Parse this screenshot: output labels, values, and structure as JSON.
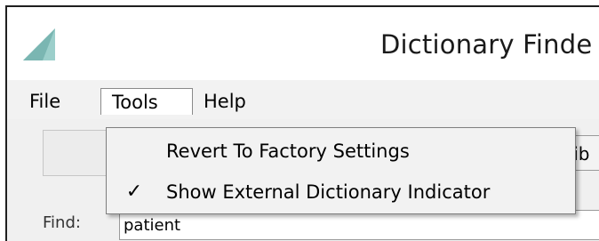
{
  "window": {
    "title": "Dictionary Finde",
    "logo_icon": "app-logo-icon",
    "accent_color": "#8fc3c0"
  },
  "menubar": {
    "items": [
      {
        "label": "File"
      },
      {
        "label": "Tools",
        "active": true
      },
      {
        "label": "Help"
      }
    ]
  },
  "tools_menu": {
    "items": [
      {
        "label": "Revert To Factory Settings",
        "checked": false
      },
      {
        "label": "Show External Dictionary Indicator",
        "checked": true,
        "check_glyph": "✓"
      }
    ]
  },
  "toolbar": {
    "partial_tab_label": "rib"
  },
  "find": {
    "label": "Find:",
    "value": "patient"
  }
}
